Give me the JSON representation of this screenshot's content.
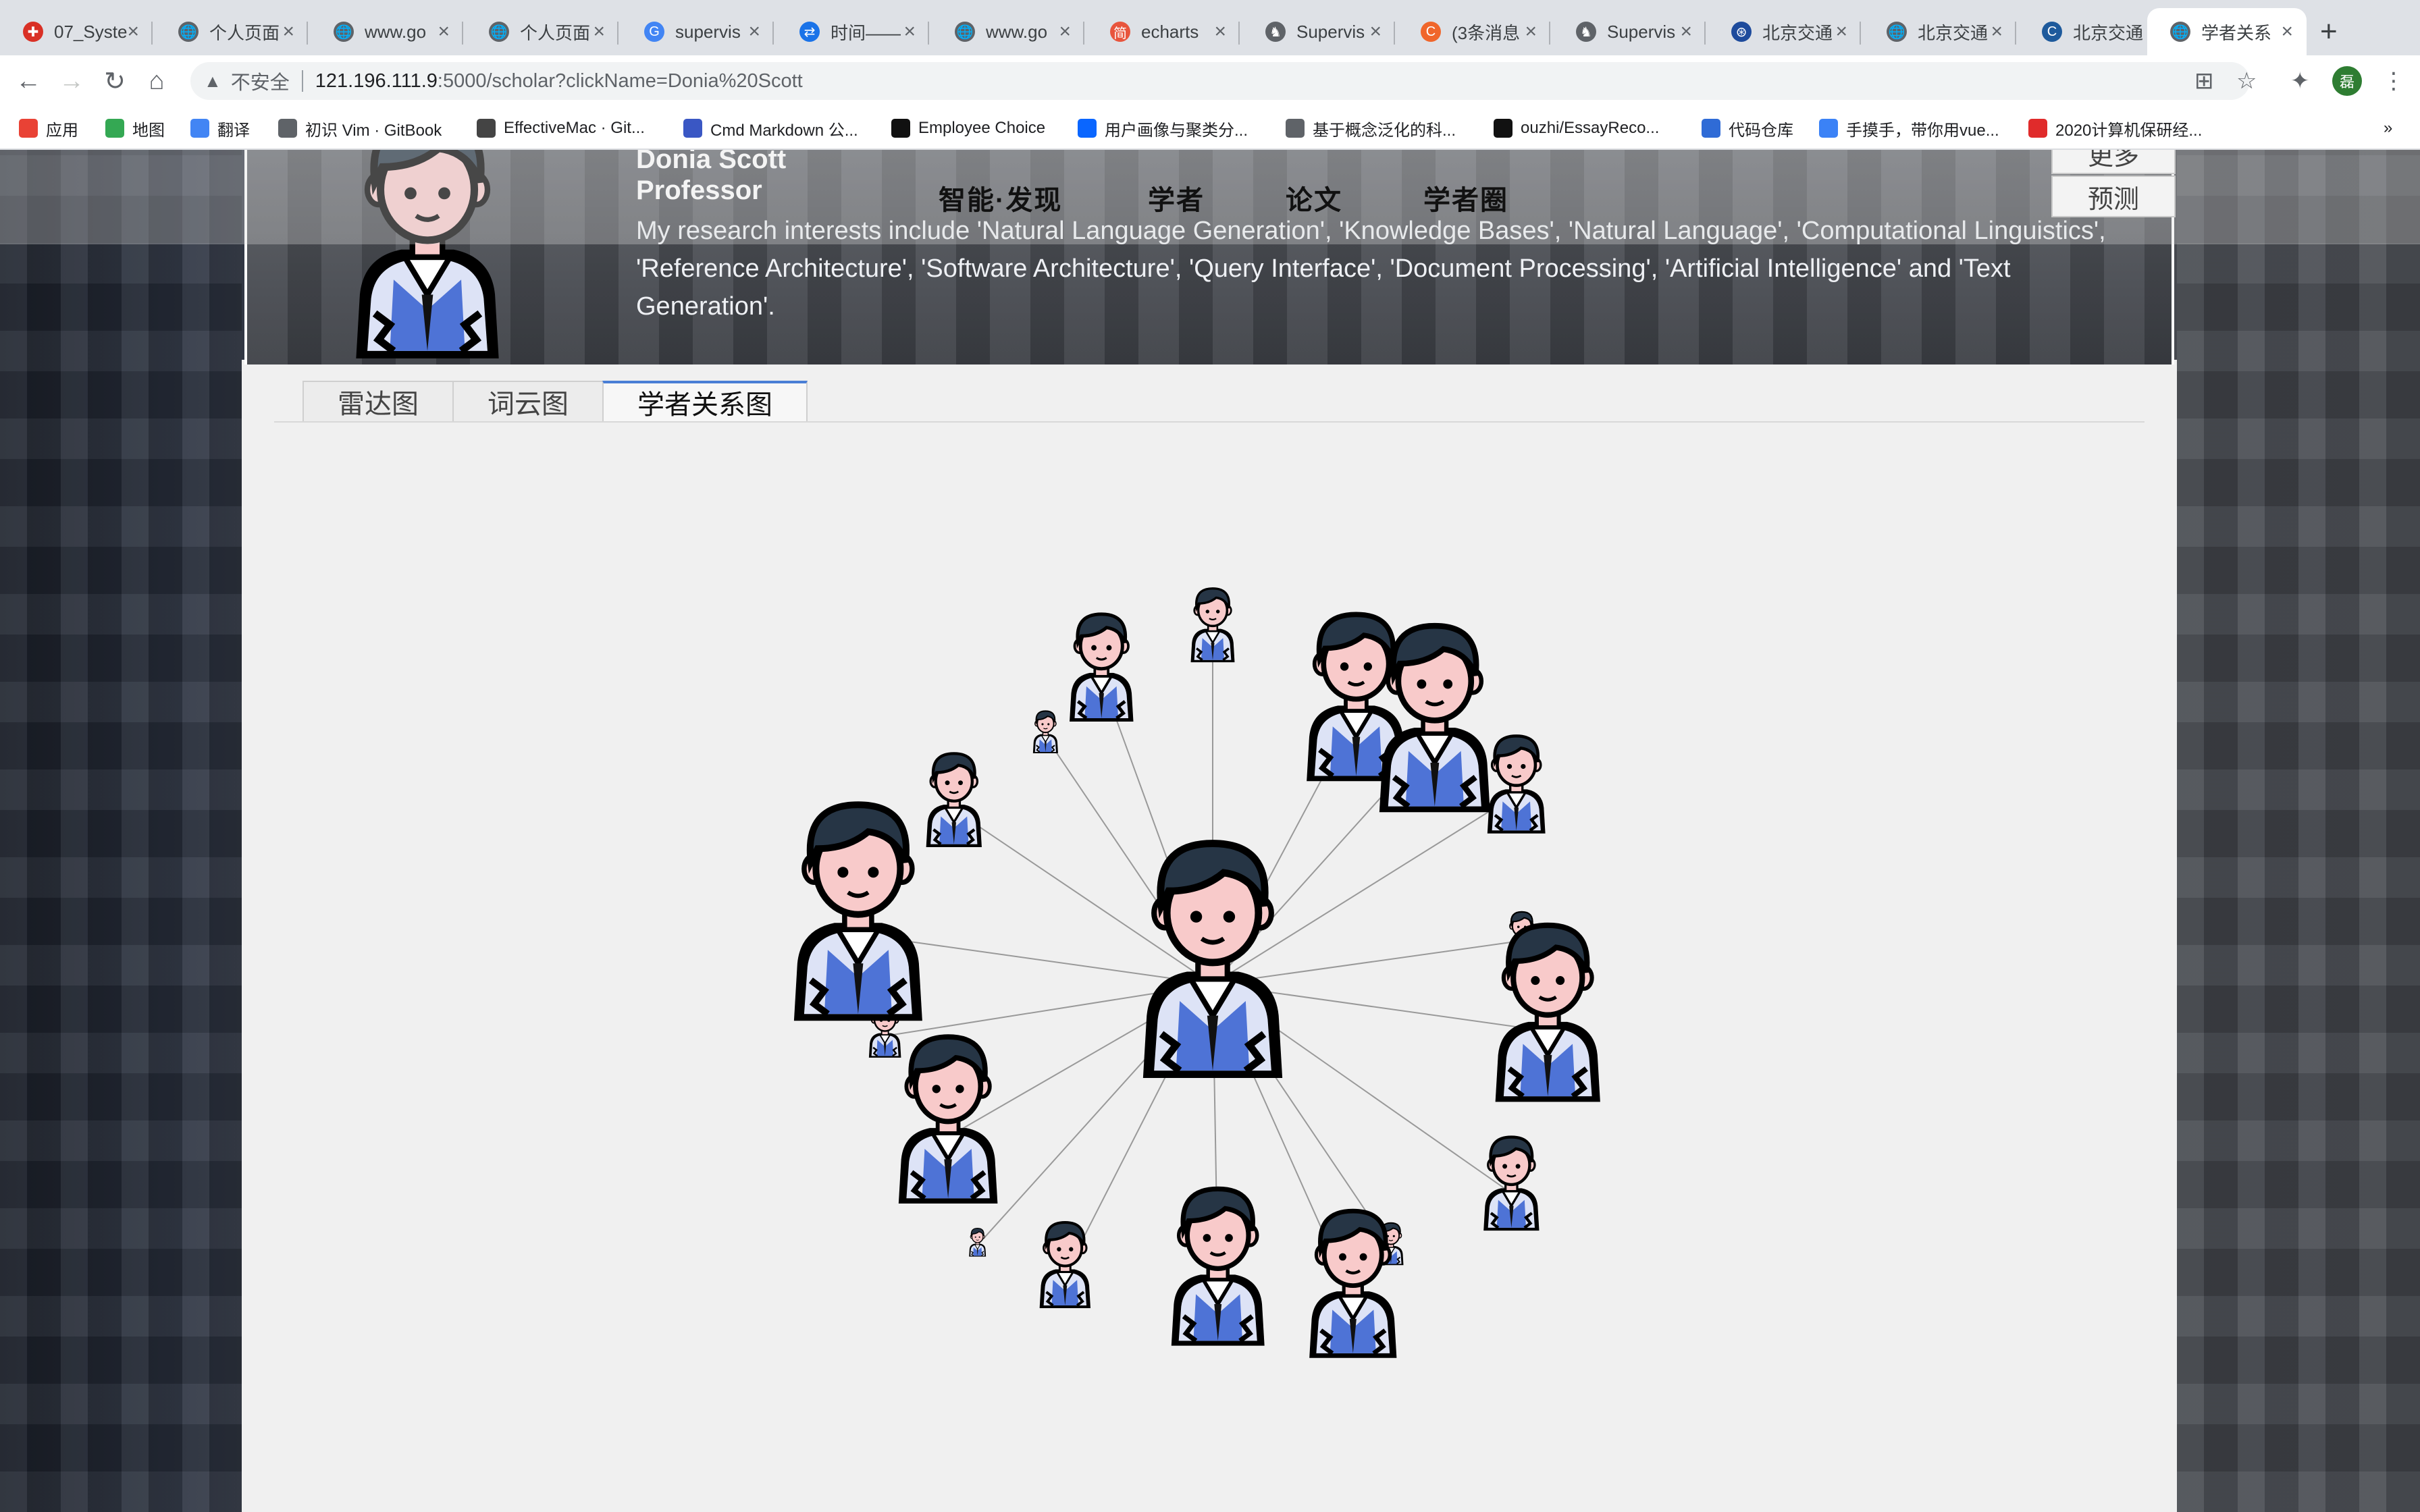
{
  "browser": {
    "tabs": [
      {
        "label": "07_Syste",
        "fav_color": "#d93025",
        "fav_glyph": "✚"
      },
      {
        "label": "个人页面",
        "fav_color": "#5f6368",
        "fav_glyph": "🌐"
      },
      {
        "label": "www.go",
        "fav_color": "#5f6368",
        "fav_glyph": "🌐"
      },
      {
        "label": "个人页面",
        "fav_color": "#5f6368",
        "fav_glyph": "🌐"
      },
      {
        "label": "supervis",
        "fav_color": "#4285f4",
        "fav_glyph": "G"
      },
      {
        "label": "时间——",
        "fav_color": "#1a73e8",
        "fav_glyph": "⇄"
      },
      {
        "label": "www.go",
        "fav_color": "#5f6368",
        "fav_glyph": "🌐"
      },
      {
        "label": "echarts",
        "fav_color": "#e8553d",
        "fav_glyph": "简"
      },
      {
        "label": "Supervis",
        "fav_color": "#5f6368",
        "fav_glyph": "♞"
      },
      {
        "label": "(3条消息",
        "fav_color": "#f0662b",
        "fav_glyph": "C"
      },
      {
        "label": "Supervis",
        "fav_color": "#5f6368",
        "fav_glyph": "♞"
      },
      {
        "label": "北京交通",
        "fav_color": "#1e4b9c",
        "fav_glyph": "⊛"
      },
      {
        "label": "北京交通",
        "fav_color": "#5f6368",
        "fav_glyph": "🌐"
      },
      {
        "label": "北京交通",
        "fav_color": "#1e5a9c",
        "fav_glyph": "C"
      },
      {
        "label": "学者关系",
        "fav_color": "#5f6368",
        "fav_glyph": "🌐"
      }
    ],
    "security_label": "不安全",
    "url_host": "121.196.111.9",
    "url_path": ":5000/scholar?clickName=Donia%20Scott",
    "profile_initial": "磊",
    "bookmarks": [
      {
        "label": "应用",
        "icon_color": "#e94235"
      },
      {
        "label": "地图",
        "icon_color": "#34a853"
      },
      {
        "label": "翻译",
        "icon_color": "#4285f4"
      },
      {
        "label": "初识 Vim · GitBook",
        "icon_color": "#5f6368"
      },
      {
        "label": "EffectiveMac · Git...",
        "icon_color": "#444"
      },
      {
        "label": "Cmd Markdown 公...",
        "icon_color": "#3a57c4"
      },
      {
        "label": "Employee Choice",
        "icon_color": "#111"
      },
      {
        "label": "用户画像与聚类分...",
        "icon_color": "#0a66ff"
      },
      {
        "label": "基于概念泛化的科...",
        "icon_color": "#5f6368"
      },
      {
        "label": "ouzhi/EssayReco...",
        "icon_color": "#111"
      },
      {
        "label": "代码仓库",
        "icon_color": "#2f6bd6"
      },
      {
        "label": "手摸手，带你用vue...",
        "icon_color": "#3b82f6"
      },
      {
        "label": "2020计算机保研经...",
        "icon_color": "#e02b2b"
      }
    ],
    "bookmarks_more": "»"
  },
  "nav": {
    "links": [
      "智能·发现",
      "学者",
      "论文",
      "学者圈"
    ],
    "more_button": "更多",
    "predict_button": "预测"
  },
  "profile": {
    "name": "Donia Scott",
    "title": "Professor",
    "bio": "My research interests include 'Natural Language Generation', 'Knowledge Bases', 'Natural Language', 'Computational Linguistics', 'Reference Architecture', 'Software Architecture', 'Query Interface', 'Document Processing', 'Artificial Intelligence' and 'Text Generation'."
  },
  "tabs": [
    "雷达图",
    "词云图",
    "学者关系图"
  ],
  "active_tab": 2,
  "colors": {
    "accent": "#4a7fd6",
    "suit": "#4e73d6",
    "edge": "#999999"
  },
  "graph": {
    "center": "Donia Scott",
    "nodes": [
      {
        "id": "n1",
        "weight": 0.12,
        "angle": -124
      },
      {
        "id": "n2",
        "weight": 0.45,
        "angle": -110
      },
      {
        "id": "n3",
        "weight": 0.28,
        "angle": -90
      },
      {
        "id": "n4",
        "weight": 0.75,
        "angle": -62
      },
      {
        "id": "n5",
        "weight": 0.85,
        "angle": -48
      },
      {
        "id": "n6",
        "weight": 0.4,
        "angle": -32
      },
      {
        "id": "n7",
        "weight": 0.15,
        "angle": -8
      },
      {
        "id": "n8",
        "weight": 0.8,
        "angle": 8
      },
      {
        "id": "n9",
        "weight": 0.38,
        "angle": 35
      },
      {
        "id": "n10",
        "weight": 0.12,
        "angle": 56
      },
      {
        "id": "n11",
        "weight": 0.65,
        "angle": 66
      },
      {
        "id": "n12",
        "weight": 0.7,
        "angle": 89
      },
      {
        "id": "n13",
        "weight": 0.34,
        "angle": 117
      },
      {
        "id": "n14",
        "weight": 0.05,
        "angle": 132
      },
      {
        "id": "n15",
        "weight": 0.75,
        "angle": 150
      },
      {
        "id": "n16",
        "weight": 0.18,
        "angle": 171
      },
      {
        "id": "n17",
        "weight": 1.0,
        "angle": 188
      },
      {
        "id": "n18",
        "weight": 0.38,
        "angle": 214
      }
    ]
  }
}
